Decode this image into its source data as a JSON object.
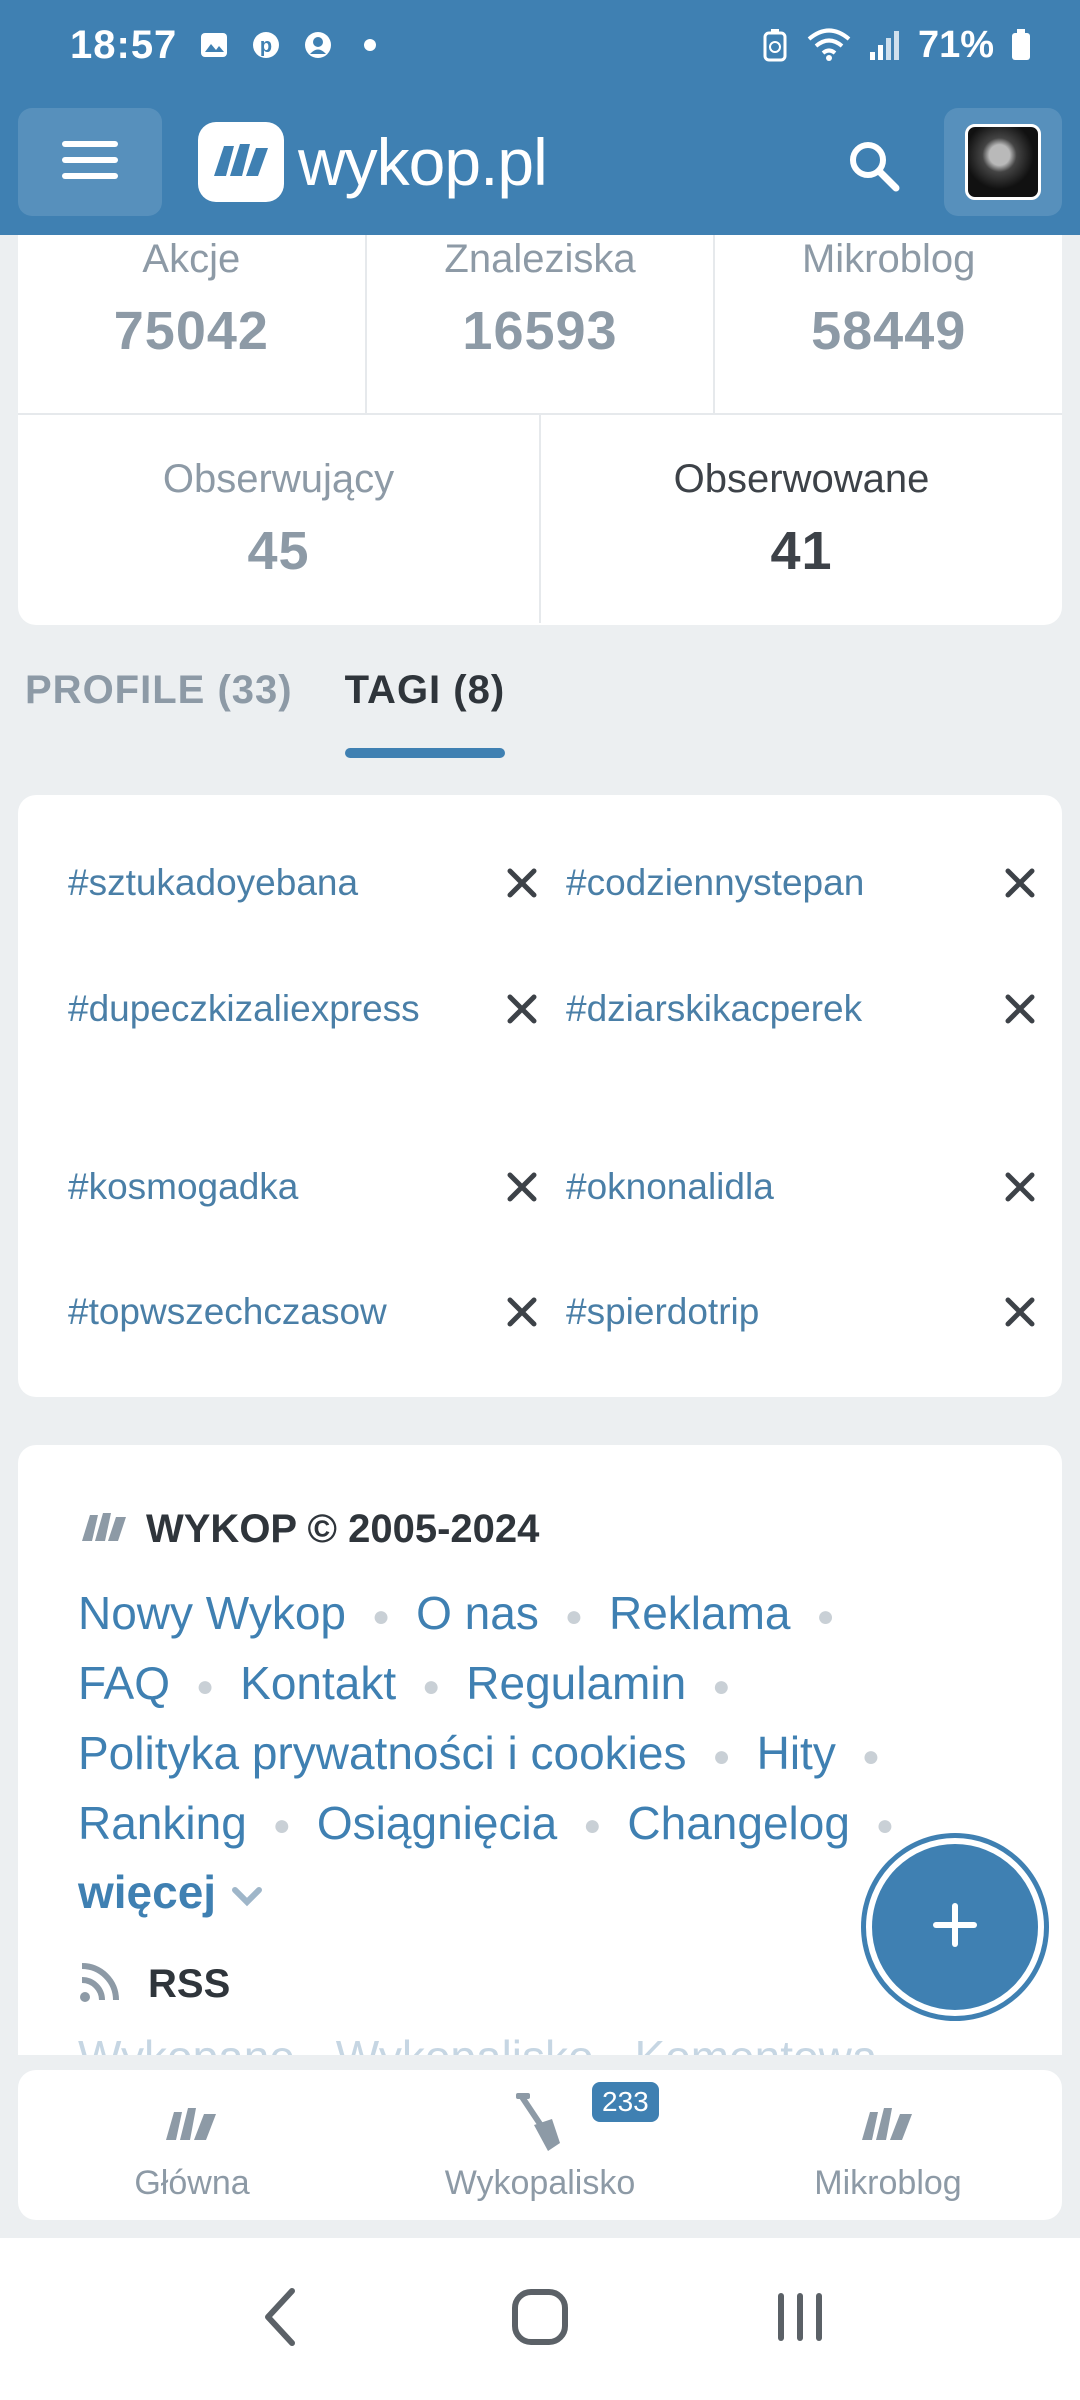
{
  "status_bar": {
    "time": "18:57",
    "battery_text": "71%",
    "icons": [
      "image-icon",
      "pinterest-icon",
      "account-icon",
      "dot-icon",
      "battery-saver-icon",
      "wifi-icon",
      "signal-icon",
      "battery-icon"
    ]
  },
  "header": {
    "logo_text": "wykop.pl",
    "icons": [
      "menu-icon",
      "search-icon",
      "avatar"
    ]
  },
  "stats": {
    "akcje_label": "Akcje",
    "akcje_value": "75042",
    "znaleziska_label": "Znaleziska",
    "znaleziska_value": "16593",
    "mikroblog_label": "Mikroblog",
    "mikroblog_value": "58449",
    "obserwujacy_label": "Obserwujący",
    "obserwujacy_value": "45",
    "obserwowane_label": "Obserwowane",
    "obserwowane_value": "41"
  },
  "tabs": {
    "profile": "PROFILE (33)",
    "tagi": "TAGI (8)",
    "active": "tagi"
  },
  "tags": [
    "#sztukadoyebana",
    "#codziennystepan",
    "#dupeczkizaliexpress",
    "#dziarskikacperek",
    "#kosmogadka",
    "#oknonalidla",
    "#topwszechczasow",
    "#spierdotrip"
  ],
  "footer": {
    "brand": "WYKOP © 2005-2024",
    "links": {
      "nowy_wykop": "Nowy Wykop",
      "o_nas": "O nas",
      "reklama": "Reklama",
      "faq": "FAQ",
      "kontakt": "Kontakt",
      "regulamin": "Regulamin",
      "polityka": "Polityka prywatności i cookies",
      "hity": "Hity",
      "ranking": "Ranking",
      "osiagniecia": "Osiągnięcia",
      "changelog": "Changelog"
    },
    "more": "więcej",
    "rss": "RSS",
    "rss_links_partial": "Wykopane · Wykopalisko · Komentowa"
  },
  "bottom_nav": {
    "glowna": "Główna",
    "wykopalisko": "Wykopalisko",
    "wykopalisko_badge": "233",
    "mikroblog": "Mikroblog"
  },
  "colors": {
    "brand": "#3f80b2",
    "text_dark": "#2f353b",
    "text_muted": "#8d9aa6",
    "tag": "#4a7fa7"
  }
}
